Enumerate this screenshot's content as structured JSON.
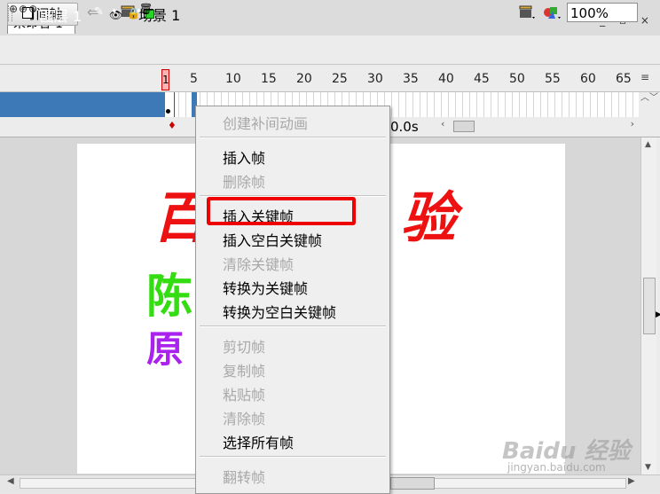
{
  "document": {
    "tab_title": "未命名-1*",
    "window_controls": "_ ▫ ×"
  },
  "toolbar": {
    "timeline_button": "时间轴",
    "back_arrow": "⇐",
    "scene_label": "场景 1",
    "zoom_value": "100%"
  },
  "timeline": {
    "playhead_frame": "1",
    "ruler_numbers": [
      "5",
      "10",
      "15",
      "20",
      "25",
      "30",
      "35",
      "40",
      "45",
      "50",
      "55",
      "60",
      "65"
    ],
    "menu_icon": "≡",
    "scroll_arrows": "︿﹀",
    "icons": {
      "eye": "eye-icon",
      "lock": "lock-icon",
      "outline": "outline-icon"
    }
  },
  "layer": {
    "name": "图层 1",
    "pencil": "✎",
    "dots": "• •",
    "color": "#2ad32a"
  },
  "footer": {
    "layer_tools": "⊕⊕⊕",
    "trash": "🗑",
    "elapsed": "0.0s"
  },
  "stage": {
    "text_left": "百",
    "text_right": "验",
    "text_green": "陈",
    "text_purple": "原 你"
  },
  "context_menu": {
    "items": [
      {
        "label": "创建补间动画",
        "enabled": false
      },
      {
        "label": "插入帧",
        "enabled": true
      },
      {
        "label": "删除帧",
        "enabled": false
      },
      {
        "label": "插入关键帧",
        "enabled": true
      },
      {
        "label": "插入空白关键帧",
        "enabled": true
      },
      {
        "label": "清除关键帧",
        "enabled": false
      },
      {
        "label": "转换为关键帧",
        "enabled": true
      },
      {
        "label": "转换为空白关键帧",
        "enabled": true
      },
      {
        "label": "剪切帧",
        "enabled": false
      },
      {
        "label": "复制帧",
        "enabled": false
      },
      {
        "label": "粘贴帧",
        "enabled": false
      },
      {
        "label": "清除帧",
        "enabled": false
      },
      {
        "label": "选择所有帧",
        "enabled": true
      },
      {
        "label": "翻转帧",
        "enabled": false
      }
    ],
    "highlight_color": "#ee0000"
  },
  "watermark": {
    "logo": "Baidu 经验",
    "url": "jingyan.baidu.com"
  }
}
